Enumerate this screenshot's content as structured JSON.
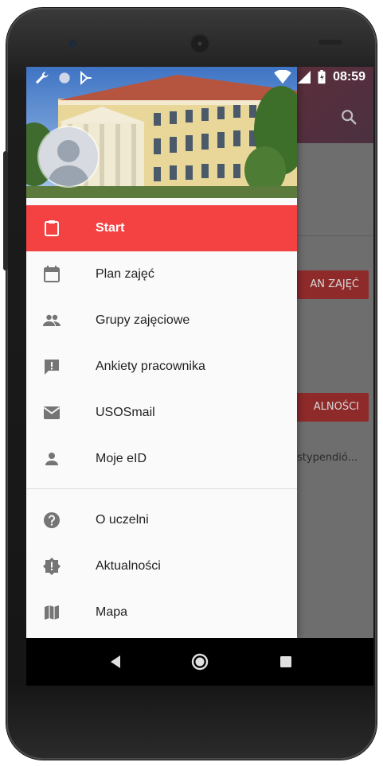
{
  "status_bar": {
    "time": "08:59",
    "icons": [
      "wrench-icon",
      "circle-icon",
      "download-icon",
      "wifi-icon",
      "signal-icon",
      "battery-icon"
    ]
  },
  "background": {
    "button1_label": "AN ZAJĘĆ",
    "button2_label": "ALNOŚCI",
    "text": "stypendió..."
  },
  "drawer": {
    "items": [
      {
        "label": "Start",
        "icon": "clipboard-icon",
        "active": true
      },
      {
        "label": "Plan zajęć",
        "icon": "calendar-icon"
      },
      {
        "label": "Grupy zajęciowe",
        "icon": "people-icon"
      },
      {
        "label": "Ankiety pracownika",
        "icon": "feedback-icon"
      },
      {
        "label": "USOSmail",
        "icon": "mail-icon"
      },
      {
        "label": "Moje eID",
        "icon": "person-icon"
      }
    ],
    "secondary_items": [
      {
        "label": "O uczelni",
        "icon": "help-icon"
      },
      {
        "label": "Aktualności",
        "icon": "announcement-icon"
      },
      {
        "label": "Mapa",
        "icon": "map-icon"
      }
    ]
  },
  "colors": {
    "accent": "#f44242",
    "drawer_bg": "#fafafa",
    "icon_gray": "#757575"
  }
}
